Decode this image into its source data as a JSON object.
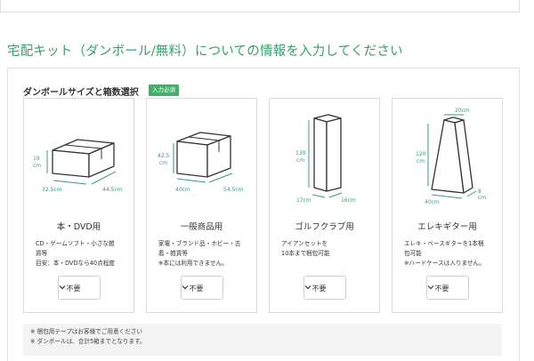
{
  "page": {
    "title": "宅配キット（ダンボール/無料）についての情報を入力してください"
  },
  "section": {
    "heading": "ダンボールサイズと箱数選択",
    "badge": "入力必須"
  },
  "colors": {
    "accent": "#35a16b",
    "badge": "#44b06a",
    "box_fill": "#ffffff",
    "box_stroke": "#333333"
  },
  "cards": [
    {
      "title": "本・DVD用",
      "dims": {
        "height": "19\ncm",
        "depth": "32.5cm",
        "width": "44.5cm"
      },
      "desc": [
        "CD・ゲームソフト・小さな雑",
        "貨等",
        "目安：本・DVDなら40点程度"
      ],
      "select": "不要",
      "icon": "small-box-icon"
    },
    {
      "title": "一般商品用",
      "dims": {
        "height": "42.5\ncm",
        "depth": "40cm",
        "width": "54.5cm"
      },
      "desc": [
        "家電・ブランド品・ホビー・古",
        "着・雑貨等",
        "※本には利用できません。"
      ],
      "select": "不要",
      "icon": "large-box-icon"
    },
    {
      "title": "ゴルフクラブ用",
      "dims": {
        "height": "130\ncm",
        "depth": "17cm",
        "width": "16cm"
      },
      "desc": [
        "アイアンセットを",
        "10本まで梱包可能"
      ],
      "select": "不要",
      "icon": "golf-box-icon"
    },
    {
      "title": "エレキギター用",
      "dims": {
        "height": "120\ncm",
        "top": "20cm",
        "depth": "40cm",
        "width": "8\ncm"
      },
      "desc": [
        "エレキ・ベースギターを1本梱",
        "包可能",
        "※ハードケースは入りません。"
      ],
      "select": "不要",
      "icon": "guitar-box-icon"
    }
  ],
  "notes": [
    "※ 梱包用テープはお客様でご用意ください",
    "※ ダンボールは、合計5箱までとなります。"
  ]
}
